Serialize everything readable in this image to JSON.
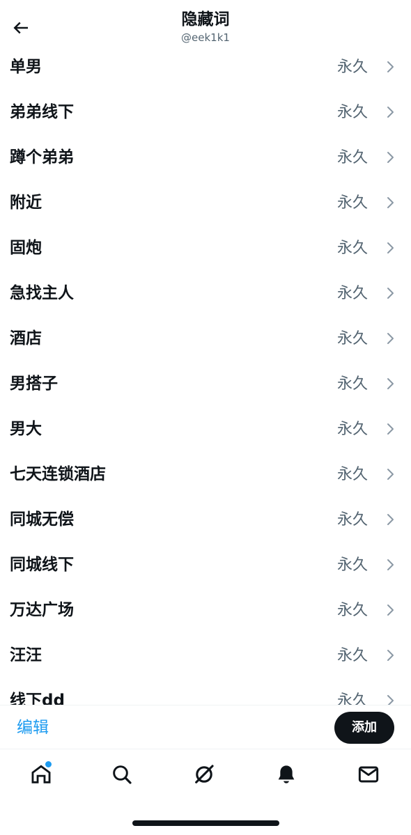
{
  "header": {
    "title": "隐藏词",
    "subtitle": "@eek1k1"
  },
  "muted_words": [
    {
      "word": "单男",
      "duration": "永久"
    },
    {
      "word": "弟弟线下",
      "duration": "永久"
    },
    {
      "word": "蹲个弟弟",
      "duration": "永久"
    },
    {
      "word": "附近",
      "duration": "永久"
    },
    {
      "word": "固炮",
      "duration": "永久"
    },
    {
      "word": "急找主人",
      "duration": "永久"
    },
    {
      "word": "酒店",
      "duration": "永久"
    },
    {
      "word": "男搭子",
      "duration": "永久"
    },
    {
      "word": "男大",
      "duration": "永久"
    },
    {
      "word": "七天连锁酒店",
      "duration": "永久"
    },
    {
      "word": "同城无偿",
      "duration": "永久"
    },
    {
      "word": "同城线下",
      "duration": "永久"
    },
    {
      "word": "万达广场",
      "duration": "永久"
    },
    {
      "word": "汪汪",
      "duration": "永久"
    },
    {
      "word": "线下dd",
      "duration": "永久"
    }
  ],
  "actions": {
    "edit_label": "编辑",
    "add_label": "添加"
  },
  "tabs": [
    {
      "name": "home",
      "icon": "home-icon",
      "has_notification_dot": true
    },
    {
      "name": "search",
      "icon": "search-icon",
      "has_notification_dot": false
    },
    {
      "name": "grok",
      "icon": "grok-icon",
      "has_notification_dot": false
    },
    {
      "name": "notifications",
      "icon": "bell-icon",
      "has_notification_dot": false
    },
    {
      "name": "messages",
      "icon": "mail-icon",
      "has_notification_dot": false
    }
  ],
  "colors": {
    "text_primary": "#0f1419",
    "text_secondary": "#536471",
    "accent": "#1d9bf0",
    "chevron": "#8b98a5"
  }
}
